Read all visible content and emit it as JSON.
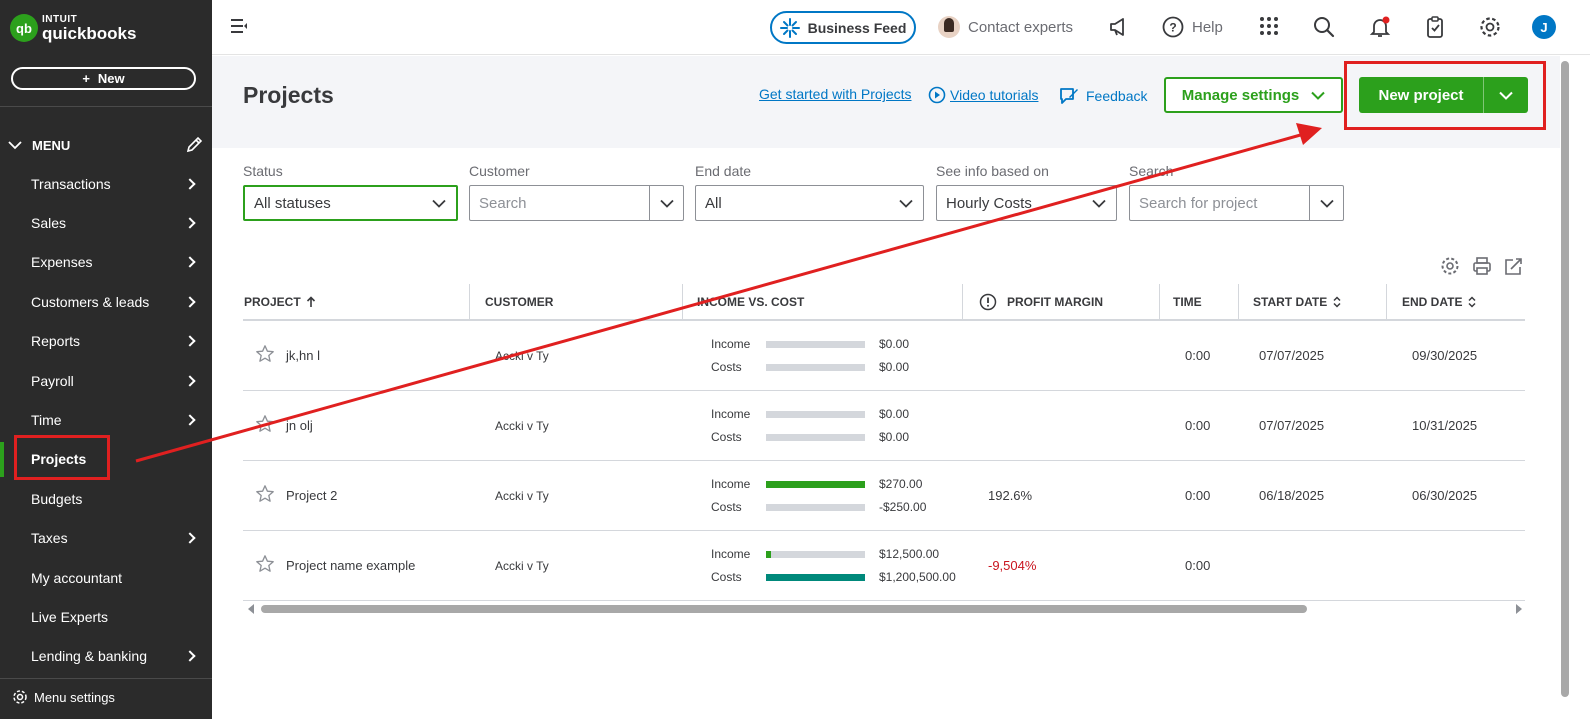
{
  "brand": {
    "company": "INTUIT",
    "product": "quickbooks"
  },
  "sidebar": {
    "new_label": "New",
    "menu_label": "MENU",
    "items": [
      {
        "label": "Transactions",
        "arrow": true
      },
      {
        "label": "Sales",
        "arrow": true
      },
      {
        "label": "Expenses",
        "arrow": true
      },
      {
        "label": "Customers & leads",
        "arrow": true
      },
      {
        "label": "Reports",
        "arrow": true
      },
      {
        "label": "Payroll",
        "arrow": true
      },
      {
        "label": "Time",
        "arrow": true
      },
      {
        "label": "Projects",
        "arrow": false,
        "active": true
      },
      {
        "label": "Budgets",
        "arrow": false
      },
      {
        "label": "Taxes",
        "arrow": true
      },
      {
        "label": "My accountant",
        "arrow": false
      },
      {
        "label": "Live Experts",
        "arrow": false
      },
      {
        "label": "Lending & banking",
        "arrow": true
      }
    ],
    "menu_settings": "Menu settings"
  },
  "topbar": {
    "business_feed": "Business Feed",
    "contact_experts": "Contact experts",
    "help": "Help",
    "user_initial": "J"
  },
  "header": {
    "title": "Projects",
    "get_started": "Get started with Projects",
    "video_tutorials": "Video tutorials",
    "feedback": "Feedback",
    "manage_settings": "Manage settings",
    "new_project": "New project"
  },
  "filters": {
    "status": {
      "label": "Status",
      "value": "All statuses"
    },
    "customer": {
      "label": "Customer",
      "placeholder": "Search"
    },
    "end_date": {
      "label": "End date",
      "value": "All"
    },
    "info_based": {
      "label": "See info based on",
      "value": "Hourly Costs"
    },
    "search": {
      "label": "Search",
      "placeholder": "Search for project"
    }
  },
  "table": {
    "columns": {
      "project": "PROJECT",
      "customer": "CUSTOMER",
      "income_vs_cost": "INCOME VS. COST",
      "profit_margin": "PROFIT MARGIN",
      "time": "TIME",
      "start_date": "START DATE",
      "end_date": "END DATE"
    },
    "income_label": "Income",
    "costs_label": "Costs",
    "rows": [
      {
        "project": "jk,hn l",
        "customer": "Accki v Ty",
        "income": "$0.00",
        "costs": "$0.00",
        "income_pct": 0,
        "costs_pct": 0,
        "profit_margin": "",
        "time": "0:00",
        "start_date": "07/07/2025",
        "end_date": "09/30/2025"
      },
      {
        "project": "jn olj",
        "customer": "Accki v Ty",
        "income": "$0.00",
        "costs": "$0.00",
        "income_pct": 0,
        "costs_pct": 0,
        "profit_margin": "",
        "time": "0:00",
        "start_date": "07/07/2025",
        "end_date": "10/31/2025"
      },
      {
        "project": "Project 2",
        "customer": "Accki v Ty",
        "income": "$270.00",
        "costs": "-$250.00",
        "income_pct": 100,
        "costs_pct": 0,
        "profit_margin": "192.6%",
        "time": "0:00",
        "start_date": "06/18/2025",
        "end_date": "06/30/2025"
      },
      {
        "project": "Project name example",
        "customer": "Accki v Ty",
        "income": "$12,500.00",
        "costs": "$1,200,500.00",
        "income_pct": 5,
        "costs_pct": 100,
        "profit_margin": "-9,504%",
        "time": "0:00",
        "start_date": "",
        "end_date": ""
      }
    ]
  },
  "colors": {
    "brand_green": "#2ca01c",
    "link_blue": "#0077c5",
    "annotation_red": "#e02020",
    "cost_teal": "#00897b",
    "negative_red": "#c9141e"
  }
}
